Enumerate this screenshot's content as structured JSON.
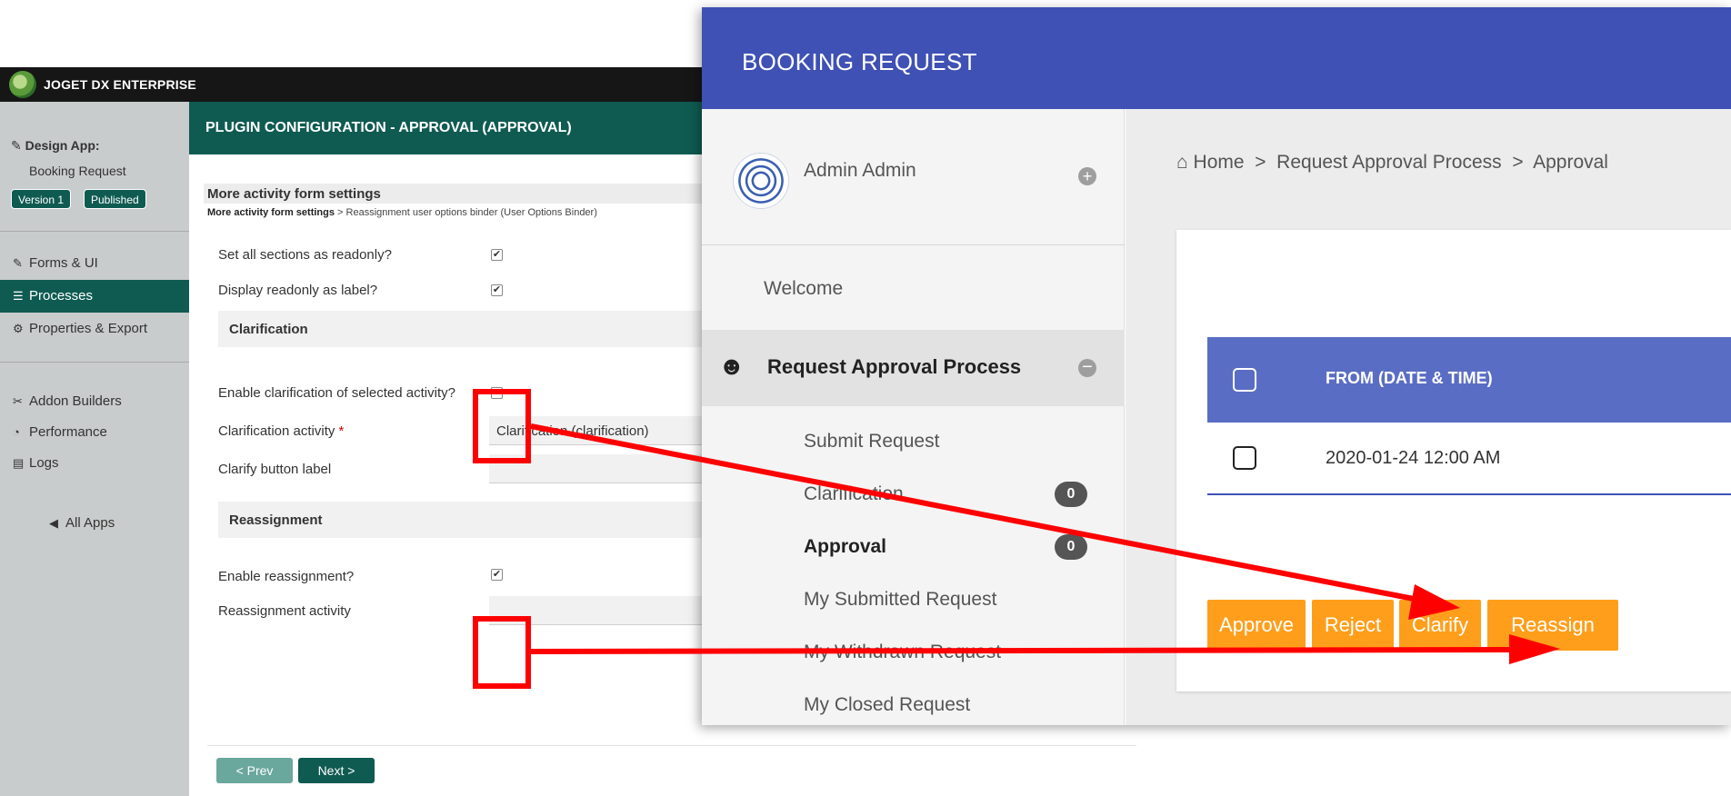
{
  "joget": {
    "brand": "JOGET DX ENTERPRISE",
    "design_app_label": "Design App:",
    "app_name": "Booking Request",
    "version_tag": "Version 1",
    "published_tag": "Published",
    "nav": {
      "forms": "Forms & UI",
      "processes": "Processes",
      "properties": "Properties & Export",
      "addon": "Addon Builders",
      "performance": "Performance",
      "logs": "Logs",
      "all_apps": "All Apps"
    },
    "plugin_title": "PLUGIN CONFIGURATION - APPROVAL (APPROVAL)",
    "section_title": "More activity form settings",
    "breadcrumb_bold": "More activity form settings",
    "breadcrumb_rest": " > Reassignment user options binder (User Options Binder)",
    "form": {
      "readonly_label": "Set all sections as readonly?",
      "display_label": "Display readonly as label?",
      "clarification_band": "Clarification",
      "enable_clarification_label": "Enable clarification of selected activity?",
      "clarification_activity_label": "Clarification activity",
      "required_mark": "*",
      "clarification_activity_value": "Clarification (clarification)",
      "clarify_button_label": "Clarify button label",
      "clarify_button_value": "",
      "reassignment_band": "Reassignment",
      "enable_reassignment_label": "Enable reassignment?",
      "reassignment_activity_label": "Reassignment activity",
      "reassignment_activity_value": "",
      "check_mark": "✔"
    },
    "prev_button": "< Prev",
    "next_button": "Next >"
  },
  "booking": {
    "header_title": "BOOKING REQUEST",
    "user_name": "Admin Admin",
    "welcome": "Welcome",
    "process_label": "Request Approval Process",
    "menu": {
      "submit": "Submit Request",
      "clarification": "Clarification",
      "clarification_count": "0",
      "approval": "Approval",
      "approval_count": "0",
      "submitted": "My Submitted Request",
      "withdrawn": "My Withdrawn Request",
      "closed": "My Closed Request"
    },
    "breadcrumb": {
      "home": "Home",
      "process": "Request Approval Process",
      "current": "Approval",
      "separator": ">"
    },
    "table": {
      "header": "FROM (DATE & TIME)",
      "rows": [
        "2020-01-24 12:00 AM"
      ]
    },
    "actions": {
      "approve": "Approve",
      "reject": "Reject",
      "clarify": "Clarify",
      "reassign": "Reassign"
    }
  },
  "colors": {
    "joget_primary": "#0f5b52",
    "booking_primary": "#3f51b5",
    "action_orange": "#ff9e1b",
    "annotation_red": "#ff0000"
  }
}
